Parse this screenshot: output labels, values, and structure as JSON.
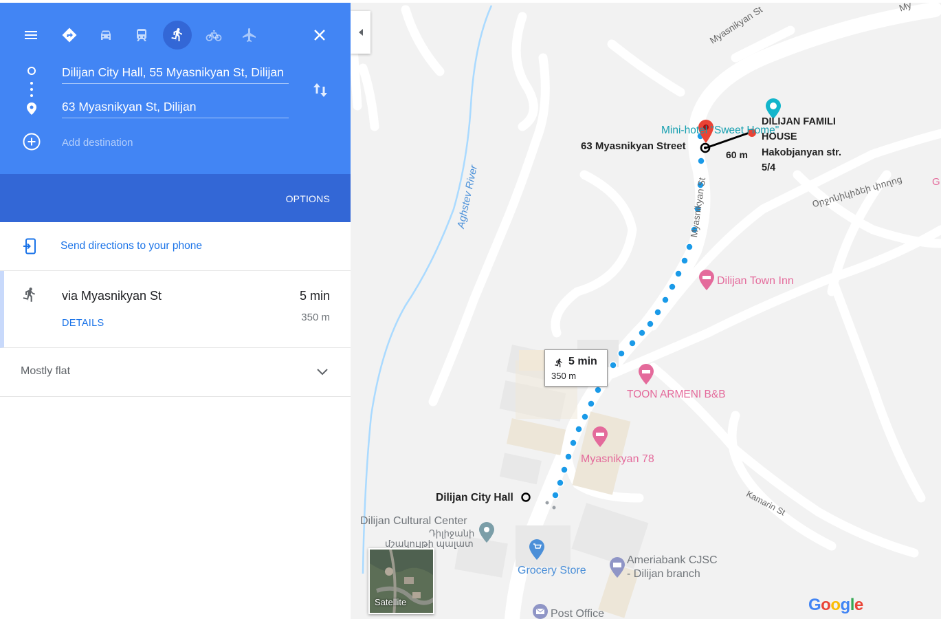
{
  "panel": {
    "origin": "Dilijan City Hall, 55 Myasnikyan St, Dilijan",
    "destination": "63 Myasnikyan St, Dilijan",
    "add_destination": "Add destination",
    "options_label": "OPTIONS",
    "travel_modes": [
      "directions-icon",
      "car-icon",
      "transit-icon",
      "walking-icon",
      "bicycle-icon",
      "flight-icon"
    ],
    "active_mode": "walking",
    "send_directions": "Send directions to your phone",
    "route": {
      "via": "via Myasnikyan St",
      "time": "5 min",
      "distance": "350 m",
      "details_label": "DETAILS"
    },
    "elevation": "Mostly flat"
  },
  "map": {
    "streets": {
      "myasnikyan_top": "Myasnikyan St",
      "myasnikyan_vertical": "Myasnikyan St",
      "agshtev_river": "Aghstev River",
      "kamarin": "Kamarin St",
      "armenian_street": "Օրջոնիկիձեի փողոց",
      "top_right_partial": "My"
    },
    "places": {
      "mini_hotel": "Mini-hotel \"Sweet Home\"",
      "dilijan_town_inn": "Dilijan Town Inn",
      "toon_armeni": "TOON ARMENI B&B",
      "myasnikyan_78": "Myasnikyan 78",
      "cultural_center": "Dilijan Cultural Center",
      "cultural_center_hy_1": "Դիլիջանի",
      "cultural_center_hy_2": "մշակույթի պալատ",
      "grocery_store": "Grocery Store",
      "ameriabank_1": "Ameriabank CJSC",
      "ameriabank_2": "- Dilijan branch",
      "post_office": "Post Office",
      "partial_edge": "G"
    },
    "annotations": {
      "street_63": "63 Myasnikyan Street",
      "distance_60": "60 m",
      "famili_house_1": "DILIJAN FAMILI",
      "famili_house_2": "HOUSE",
      "famili_addr_1": "Hakobjanyan str.",
      "famili_addr_2": "5/4",
      "city_hall": "Dilijan City Hall"
    },
    "route_bubble": {
      "time": "5 min",
      "distance": "350 m"
    },
    "satellite_label": "Satellite",
    "logo": "Google",
    "colors": {
      "route_dot": "#1a9ae8",
      "hotel_pin": "#e46a9b",
      "poi_blue": "#4b8fd8",
      "destination_pin": "#ea4335",
      "header_blue": "#4285f4",
      "options_blue": "#3367d6"
    }
  }
}
